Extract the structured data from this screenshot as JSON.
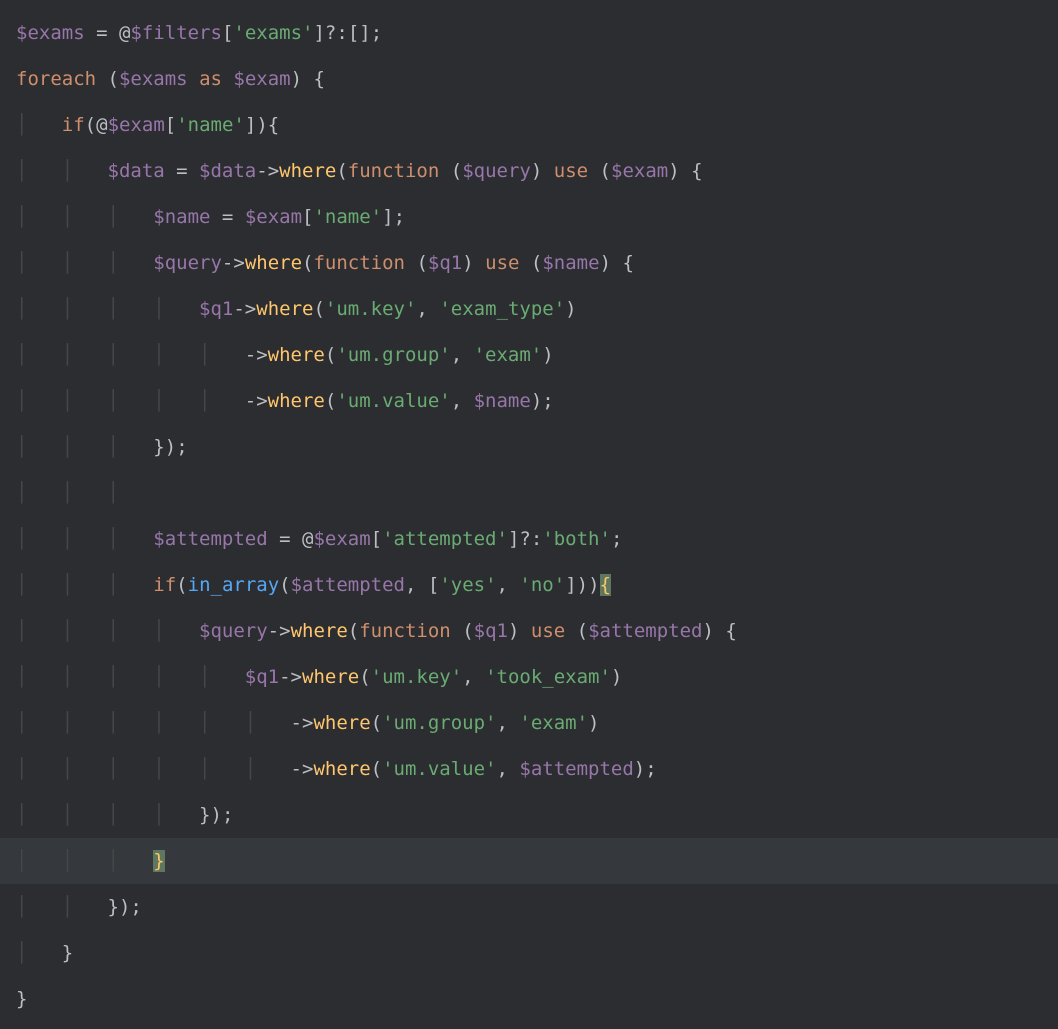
{
  "colors": {
    "background": "#2b2d30",
    "highlight_line": "#35383d",
    "variable": "#9876aa",
    "keyword": "#cf8e6d",
    "string": "#6aab73",
    "method": "#56a8f5",
    "method_call": "#ffc66d",
    "plain": "#bcbec4",
    "guide": "#454749",
    "brace_match_bg": "#5e775e"
  },
  "language": "php",
  "t": {
    "v_exams": "$exams",
    "v_filters": "$filters",
    "v_exam": "$exam",
    "v_data": "$data",
    "v_query": "$query",
    "v_name": "$name",
    "v_q1": "$q1",
    "v_attempted": "$attempted",
    "kw_foreach": "foreach",
    "kw_as": "as",
    "kw_if": "if",
    "kw_function": "function",
    "kw_use": "use",
    "fn_in_array": "in_array",
    "m_where": "where",
    "s_exams": "'exams'",
    "s_name": "'name'",
    "s_um_key": "'um.key'",
    "s_exam_type": "'exam_type'",
    "s_um_group": "'um.group'",
    "s_exam": "'exam'",
    "s_um_value": "'um.value'",
    "s_attempted": "'attempted'",
    "s_both": "'both'",
    "s_yes": "'yes'",
    "s_no": "'no'",
    "s_took_exam": "'took_exam'",
    "eq": " = ",
    "at": "@",
    "arrow": "->",
    "tern": "?:",
    "empty_arr": "[]",
    "semi": ";",
    "comma": ", ",
    "lp": "(",
    "rp": ")",
    "lb": "[",
    "rb": "]",
    "lc": "{",
    "rc": "}",
    "sp": " "
  },
  "highlighted_line_index": 18
}
